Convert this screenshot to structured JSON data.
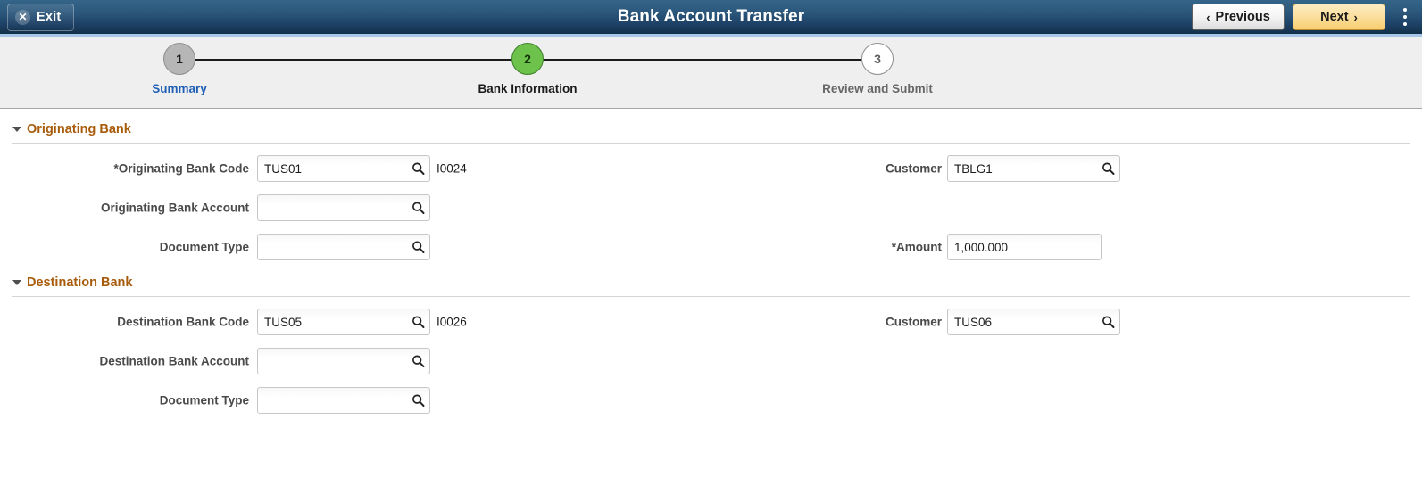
{
  "header": {
    "exit_label": "Exit",
    "exit_icon": "close-x-icon",
    "title": "Bank Account Transfer",
    "previous_label": "Previous",
    "next_label": "Next",
    "prev_chevron": "‹",
    "next_chevron": "›",
    "menu_icon": "kebab-menu-icon",
    "accent_color": "#a8c7e8",
    "bar_color": "#1e4267"
  },
  "stepper": {
    "steps": [
      {
        "number": "1",
        "label": "Summary",
        "state": "done"
      },
      {
        "number": "2",
        "label": "Bank Information",
        "state": "current"
      },
      {
        "number": "3",
        "label": "Review and Submit",
        "state": "todo"
      }
    ],
    "current_color": "#6cc24a",
    "done_color": "#b6b6b6",
    "link_color": "#1f5fb5"
  },
  "sections": [
    {
      "title": "Originating Bank",
      "title_color": "#a85c0b",
      "left_fields": [
        {
          "label": "*Originating Bank Code",
          "value": "TUS01",
          "lookup": true,
          "side_text": "I0024"
        },
        {
          "label": "Originating Bank Account",
          "value": "",
          "lookup": true,
          "side_text": ""
        },
        {
          "label": "Document Type",
          "value": "",
          "lookup": true,
          "side_text": ""
        }
      ],
      "right_fields": [
        {
          "label": "Customer",
          "value": "TBLG1",
          "lookup": true,
          "row": 0
        },
        {
          "label": "*Amount",
          "value": "1,000.000",
          "lookup": false,
          "row": 2
        }
      ]
    },
    {
      "title": "Destination Bank",
      "title_color": "#a85c0b",
      "left_fields": [
        {
          "label": "Destination Bank Code",
          "value": "TUS05",
          "lookup": true,
          "side_text": "I0026"
        },
        {
          "label": "Destination Bank Account",
          "value": "",
          "lookup": true,
          "side_text": ""
        },
        {
          "label": "Document Type",
          "value": "",
          "lookup": true,
          "side_text": ""
        }
      ],
      "right_fields": [
        {
          "label": "Customer",
          "value": "TUS06",
          "lookup": true,
          "row": 0
        }
      ]
    }
  ],
  "icons": {
    "lookup": "magnifier-search-icon"
  }
}
